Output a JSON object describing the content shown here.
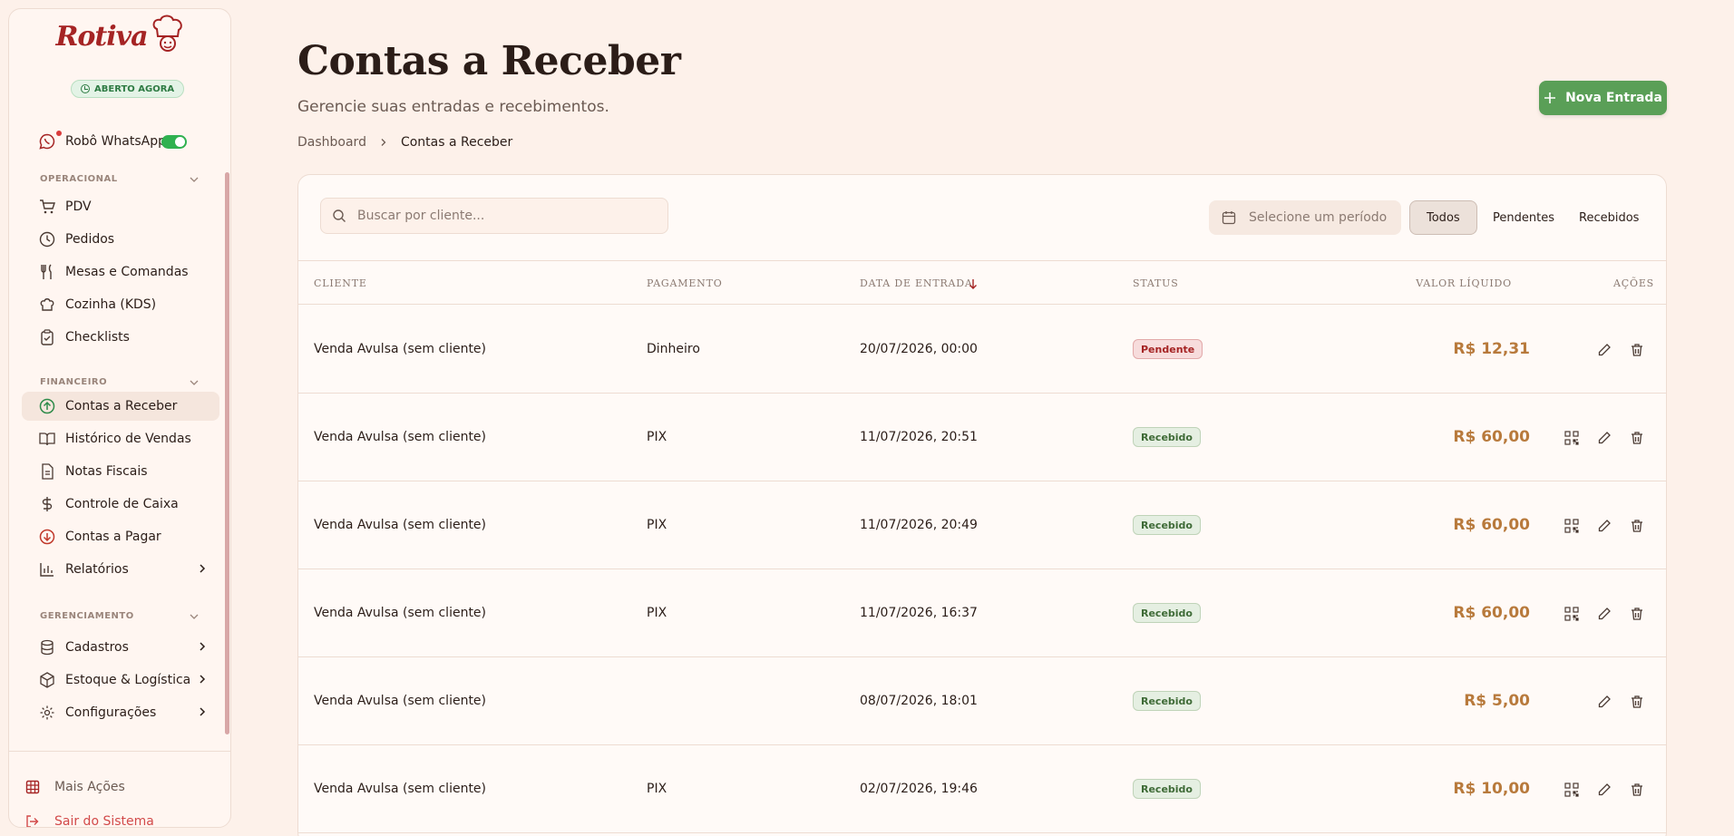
{
  "sidebar": {
    "logo": "Rotiva",
    "open_badge": "ABERTO AGORA",
    "whatsapp": "Robô WhatsApp",
    "sections": {
      "operacional": "OPERACIONAL",
      "financeiro": "FINANCEIRO",
      "gerenciamento": "GERENCIAMENTO"
    },
    "items": {
      "pdv": "PDV",
      "pedidos": "Pedidos",
      "mesas": "Mesas e Comandas",
      "cozinha": "Cozinha (KDS)",
      "checklists": "Checklists",
      "contas_receber": "Contas a Receber",
      "historico": "Histórico de Vendas",
      "notas": "Notas Fiscais",
      "caixa": "Controle de Caixa",
      "contas_pagar": "Contas a Pagar",
      "relatorios": "Relatórios",
      "cadastros": "Cadastros",
      "estoque": "Estoque & Logística",
      "configuracoes": "Configurações"
    },
    "bottom": {
      "mais_acoes": "Mais Ações",
      "sair": "Sair do Sistema"
    }
  },
  "header": {
    "title": "Contas a Receber",
    "subtitle": "Gerencie suas entradas e recebimentos.",
    "breadcrumb": [
      "Dashboard",
      "Contas a Receber"
    ],
    "new_button": "Nova Entrada"
  },
  "toolbar": {
    "search_placeholder": "Buscar por cliente...",
    "period_placeholder": "Selecione um período",
    "filters": [
      "Todos",
      "Pendentes",
      "Recebidos"
    ],
    "active_filter": "Todos"
  },
  "table": {
    "columns": [
      "CLIENTE",
      "PAGAMENTO",
      "DATA DE ENTRADA",
      "STATUS",
      "VALOR LÍQUIDO",
      "AÇÕES"
    ],
    "rows": [
      {
        "cliente": "Venda Avulsa (sem cliente)",
        "pagamento": "Dinheiro",
        "data": "20/07/2026, 00:00",
        "status": "Pendente",
        "valor": "R$ 12,31"
      },
      {
        "cliente": "Venda Avulsa (sem cliente)",
        "pagamento": "PIX",
        "data": "11/07/2026, 20:51",
        "status": "Recebido",
        "valor": "R$ 60,00"
      },
      {
        "cliente": "Venda Avulsa (sem cliente)",
        "pagamento": "PIX",
        "data": "11/07/2026, 20:49",
        "status": "Recebido",
        "valor": "R$ 60,00"
      },
      {
        "cliente": "Venda Avulsa (sem cliente)",
        "pagamento": "PIX",
        "data": "11/07/2026, 16:37",
        "status": "Recebido",
        "valor": "R$ 60,00"
      },
      {
        "cliente": "Venda Avulsa (sem cliente)",
        "pagamento": "",
        "data": "08/07/2026, 18:01",
        "status": "Recebido",
        "valor": "R$ 5,00"
      },
      {
        "cliente": "Venda Avulsa (sem cliente)",
        "pagamento": "PIX",
        "data": "02/07/2026, 19:46",
        "status": "Recebido",
        "valor": "R$ 10,00"
      }
    ]
  },
  "colors": {
    "brand": "#a52424",
    "primary_button": "#5a9f57",
    "value_text": "#b87a3c",
    "background": "#fdf1ea"
  }
}
